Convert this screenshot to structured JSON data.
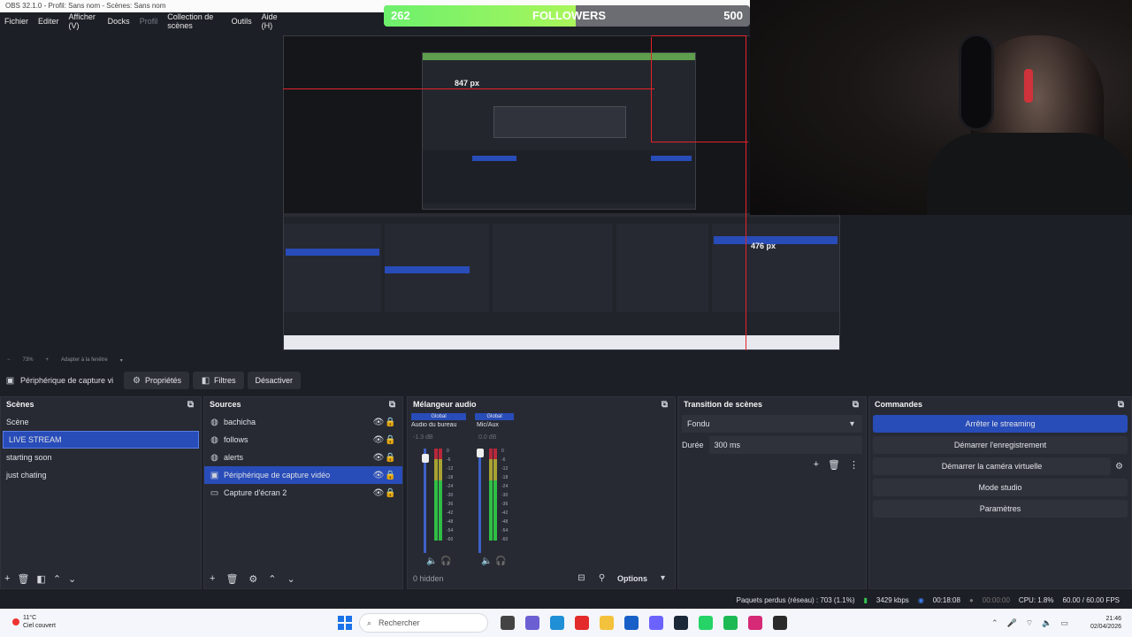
{
  "window": {
    "title": "OBS 32.1.0 - Profil: Sans nom - Scènes: Sans nom"
  },
  "menu": {
    "items": [
      "Fichier",
      "Editer",
      "Afficher (V)",
      "Docks",
      "Profil",
      "Collection de scènes",
      "Outils",
      "Aide (H)"
    ]
  },
  "followers": {
    "current": "262",
    "label": "FOLLOWERS",
    "goal": "500",
    "progress": 0.524
  },
  "preview": {
    "measure_top": "847 px",
    "measure_right": "476 px"
  },
  "zoom": {
    "level": "73%",
    "fit": "Adapter à la fenêtre"
  },
  "source_toolbar": {
    "source_name": "Périphérique de capture vi",
    "properties": "Propriétés",
    "filters": "Filtres",
    "deactivate": "Désactiver"
  },
  "scenes": {
    "title": "Scènes",
    "items": [
      "Scène",
      "LIVE STREAM",
      "starting soon",
      "just chating"
    ],
    "selected_index": 1
  },
  "sources": {
    "title": "Sources",
    "items": [
      "bachicha",
      "follows",
      "alerts",
      "Périphérique de capture vidéo",
      "Capture d'écran 2"
    ],
    "selected_index": 3
  },
  "audio": {
    "title": "Mélangeur audio",
    "ch1": {
      "tag": "Global",
      "name": "Audio du bureau",
      "db": "-1.3 dB"
    },
    "ch2": {
      "tag": "Global",
      "name": "Mic/Aux",
      "db": "0.0 dB"
    },
    "scale": [
      "0",
      "-6",
      "-12",
      "-18",
      "-24",
      "-30",
      "-36",
      "-42",
      "-48",
      "-54",
      "-60"
    ],
    "hidden": "0 hidden",
    "options": "Options"
  },
  "transition": {
    "title": "Transition de scènes",
    "type": "Fondu",
    "duration_label": "Durée",
    "duration_value": "300 ms"
  },
  "commands": {
    "title": "Commandes",
    "stop_stream": "Arrêter le streaming",
    "start_rec": "Démarrer l'enregistrement",
    "virtual_cam": "Démarrer la caméra virtuelle",
    "studio": "Mode studio",
    "settings": "Paramètres"
  },
  "status": {
    "dropped": "Paquets perdus (réseau) : 703 (1.1%)",
    "bitrate": "3429 kbps",
    "stream_time": "00:18:08",
    "rec_time": "00:00:00",
    "cpu": "CPU: 1.8%",
    "fps": "60.00 / 60.00 FPS"
  },
  "taskbar": {
    "weather_temp": "11°C",
    "weather_desc": "Ciel couvert",
    "search": "Rechercher",
    "time": "21:46",
    "date": "02/04/2026"
  },
  "colors": {
    "accent": "#284cb8",
    "bg": "#1d1f26",
    "dock": "#272a33",
    "meter_green": "#2fbe45",
    "meter_red": "#c02b2b"
  }
}
